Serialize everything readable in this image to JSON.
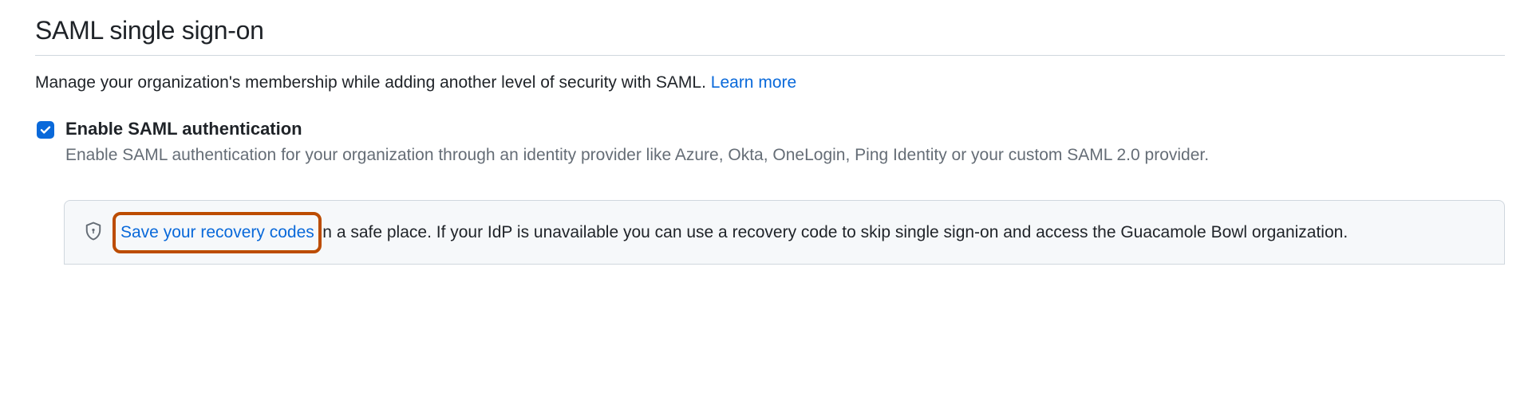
{
  "heading": "SAML single sign-on",
  "intro": {
    "text": "Manage your organization's membership while adding another level of security with SAML. ",
    "learn_more": "Learn more"
  },
  "enable": {
    "label": "Enable SAML authentication",
    "description": "Enable SAML authentication for your organization through an identity provider like Azure, Okta, OneLogin, Ping Identity or your custom SAML 2.0 provider."
  },
  "callout": {
    "link_text": "Save your recovery codes",
    "rest_text": " in a safe place. If your IdP is unavailable you can use a recovery code to skip single sign-on and access the Guacamole Bowl organization."
  }
}
